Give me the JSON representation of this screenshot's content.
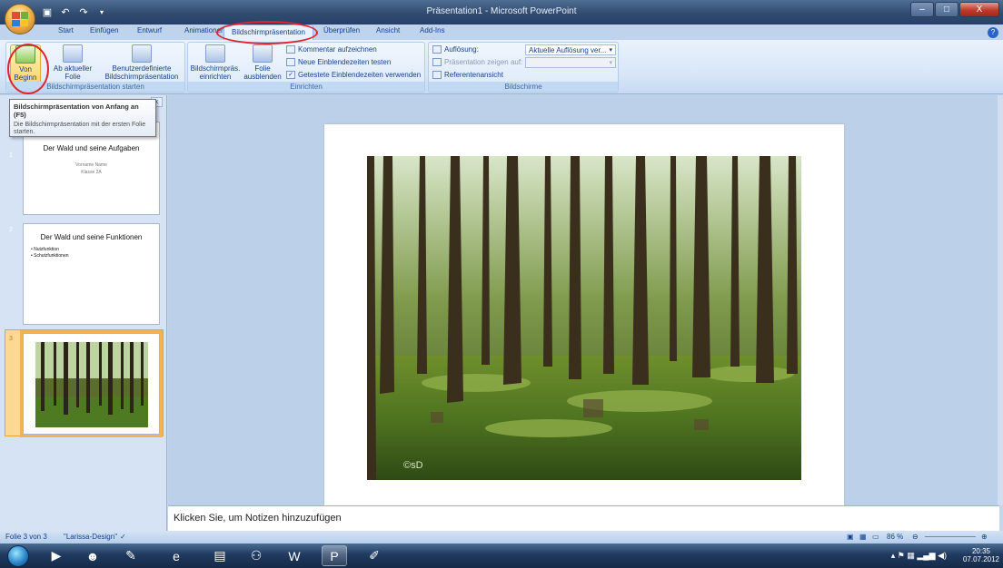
{
  "window": {
    "title": "Präsentation1 - Microsoft PowerPoint",
    "minimize": "–",
    "maximize": "□",
    "close": "X"
  },
  "qat": {
    "save_icon": "save-icon",
    "undo_icon": "undo-icon",
    "redo_icon": "redo-icon"
  },
  "tabs": [
    "Start",
    "Einfügen",
    "Entwurf",
    "Animationen",
    "Bildschirmpräsentation",
    "Überprüfen",
    "Ansicht",
    "Add-Ins"
  ],
  "active_tab": "Bildschirmpräsentation",
  "ribbon": {
    "group_start": {
      "label": "Bildschirmpräsentation starten",
      "von_beginn": "Von\nBeginn an",
      "aktuelle_folie": "Ab aktueller\nFolie",
      "benutzerdef": "Benutzerdefinierte\nBildschirmpräsentation"
    },
    "group_einrichten": {
      "label": "Einrichten",
      "einrichten": "Bildschirmpräs.\neinrichten",
      "ausblenden": "Folie\nausblenden",
      "kommentar": "Kommentar aufzeichnen",
      "einblendezeiten_testen": "Neue Einblendezeiten testen",
      "einblendezeiten_verwenden": "Getestete Einblendezeiten verwenden"
    },
    "group_bildschirme": {
      "label": "Bildschirme",
      "aufloesung": "Auflösung:",
      "aufloesung_value": "Aktuelle Auflösung ver...",
      "praesentation_zeigen": "Präsentation zeigen auf:",
      "referentenansicht": "Referentenansicht"
    }
  },
  "tooltip": {
    "title": "Bildschirmpräsentation von Anfang an (F5)",
    "body": "Die Bildschirmpräsentation mit der ersten Folie starten."
  },
  "slides": [
    {
      "num": "1",
      "title": "Der Wald und seine Aufgaben",
      "sub1": "Vorname Name",
      "sub2": "Klasse 2A"
    },
    {
      "num": "2",
      "title": "Der Wald und seine Funktionen",
      "bullets": [
        "• Nutzfunktion",
        "• Schutzfunktionen"
      ]
    },
    {
      "num": "3"
    }
  ],
  "photo_credit": "©sD",
  "notes_placeholder": "Klicken Sie, um Notizen hinzuzufügen",
  "status": {
    "slide_info": "Folie 3 von 3",
    "theme": "\"Larissa-Design\"",
    "zoom": "86 %"
  },
  "tray": {
    "time": "20:35",
    "date": "07.07.2012"
  },
  "colors": {
    "accent": "#e0232e",
    "ribbon": "#dce9f9",
    "selection": "#f5b350"
  }
}
